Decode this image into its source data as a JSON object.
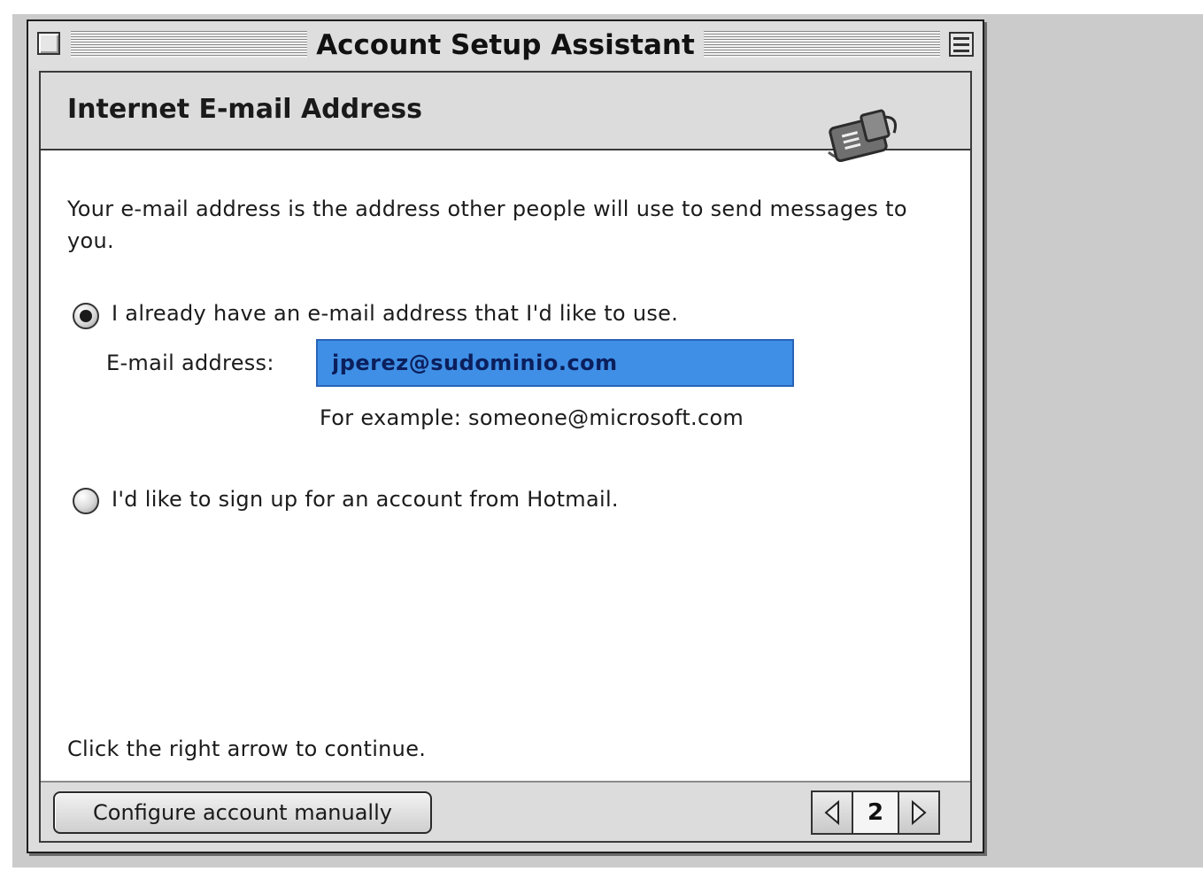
{
  "window": {
    "title": "Account Setup Assistant"
  },
  "header": {
    "title": "Internet E-mail Address",
    "icon": "mail-icon"
  },
  "content": {
    "intro": "Your e-mail address is the address other people will use to send messages to you.",
    "option_existing": {
      "label": "I already have an e-mail address that I'd like to use.",
      "selected": true
    },
    "email_field": {
      "label": "E-mail address:",
      "value": "jperez@sudominio.com"
    },
    "example_text": "For example: someone@microsoft.com",
    "option_hotmail": {
      "label": "I'd like to sign up for an account from Hotmail.",
      "selected": false
    },
    "continue_hint": "Click the right arrow to continue."
  },
  "footer": {
    "manual_button": "Configure account manually",
    "page_number": "2"
  },
  "colors": {
    "field_highlight": "#3f8fe6",
    "field_text": "#0b1f5c",
    "window_gray": "#dcdcdc"
  }
}
